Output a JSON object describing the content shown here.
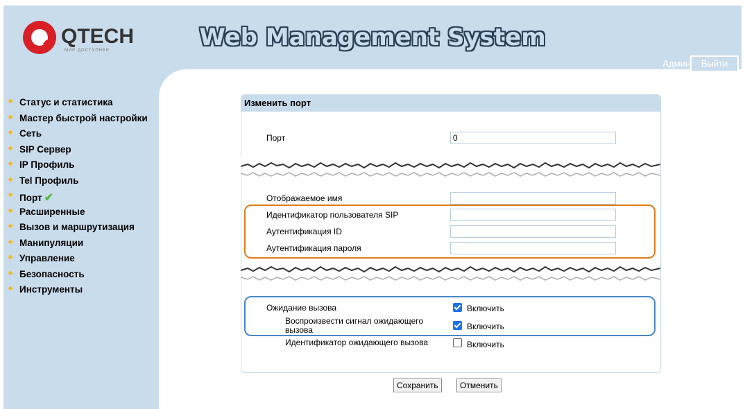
{
  "header": {
    "brand": "QTECH",
    "brand_tagline": "МИР ДОСТУПНЕЕ",
    "title": "Web Management System",
    "user": "Админ",
    "logout_label": "Выйти",
    "background_color": "#c9dcec"
  },
  "sidebar": {
    "items": [
      {
        "label": "Статус и статистика"
      },
      {
        "label": "Мастер быстрой настройки"
      },
      {
        "label": "Сеть"
      },
      {
        "label": "SIP Сервер"
      },
      {
        "label": "IP Профиль"
      },
      {
        "label": "Tel Профиль"
      },
      {
        "label": "Порт",
        "active": true,
        "icon": "checkmark-icon"
      },
      {
        "label": "Расширенные"
      },
      {
        "label": "Вызов и маршрутизация"
      },
      {
        "label": "Манипуляции"
      },
      {
        "label": "Управление"
      },
      {
        "label": "Безопасность"
      },
      {
        "label": "Инструменты"
      }
    ]
  },
  "panel": {
    "title": "Изменить порт",
    "fields": {
      "port": {
        "label": "Порт",
        "value": "0"
      },
      "display_name": {
        "label": "Отображаемое имя",
        "value": ""
      },
      "sip_user_id": {
        "label": "Идентификатор пользователя SIP",
        "value": ""
      },
      "auth_id": {
        "label": "Аутентификация ID",
        "value": ""
      },
      "auth_password": {
        "label": "Аутентификация пароля",
        "value": ""
      }
    },
    "options": {
      "call_waiting": {
        "label": "Ожидание вызова",
        "checkbox_label": "Включить",
        "checked": true
      },
      "play_call_waiting_tone": {
        "label": "Воспроизвести сигнал ожидающего вызова",
        "checkbox_label": "Включить",
        "checked": true
      },
      "call_waiting_caller_id": {
        "label": "Идентификатор ожидающего вызова",
        "checkbox_label": "Включить",
        "checked": false
      }
    }
  },
  "actions": {
    "save_label": "Сохранить",
    "cancel_label": "Отменить"
  },
  "highlights": {
    "orange": "#e07b1a",
    "blue": "#4a86c8"
  }
}
